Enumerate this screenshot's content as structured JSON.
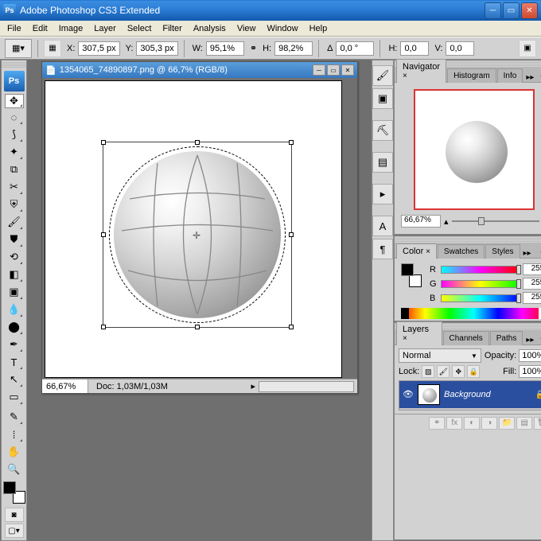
{
  "app": {
    "title": "Adobe Photoshop CS3 Extended",
    "logo": "Ps"
  },
  "menu": [
    "File",
    "Edit",
    "Image",
    "Layer",
    "Select",
    "Filter",
    "Analysis",
    "View",
    "Window",
    "Help"
  ],
  "options": {
    "x_label": "X:",
    "x": "307,5 px",
    "y_label": "Y:",
    "y": "305,3 px",
    "w_label": "W:",
    "w": "95,1%",
    "h_label": "H:",
    "h": "98,2%",
    "angle_label": "Δ",
    "angle": "0,0    °",
    "hskew_label": "H:",
    "hskew": "0,0",
    "vskew_label": "V:",
    "vskew": "0,0"
  },
  "document": {
    "title": "1354065_74890897.png @ 66,7% (RGB/8)",
    "zoom": "66,67%",
    "docinfo": "Doc: 1,03M/1,03M"
  },
  "navigator": {
    "tabs": [
      "Navigator",
      "Histogram",
      "Info"
    ],
    "zoom": "66,67%"
  },
  "color": {
    "tabs": [
      "Color",
      "Swatches",
      "Styles"
    ],
    "r_label": "R",
    "r": "255",
    "g_label": "G",
    "g": "255",
    "b_label": "B",
    "b": "255"
  },
  "layers": {
    "tabs": [
      "Layers",
      "Channels",
      "Paths"
    ],
    "blend": "Normal",
    "opacity_label": "Opacity:",
    "opacity": "100%",
    "lock_label": "Lock:",
    "fill_label": "Fill:",
    "fill": "100%",
    "layer_name": "Background"
  }
}
